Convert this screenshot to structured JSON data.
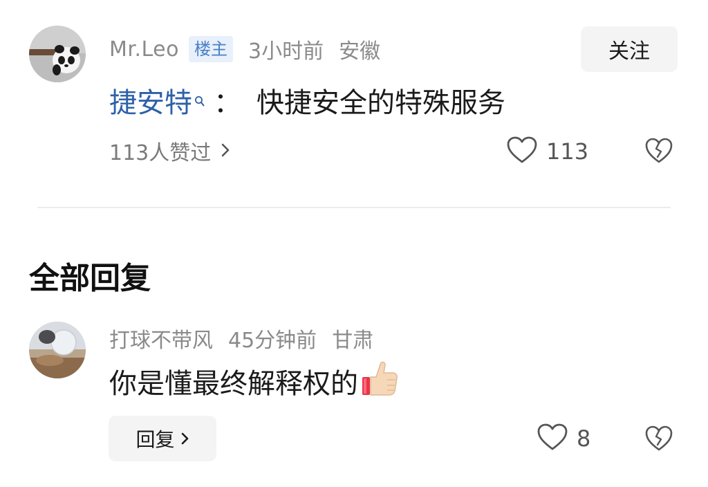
{
  "post": {
    "author": "Mr.Leo",
    "badge": "楼主",
    "time": "3小时前",
    "location": "安徽",
    "follow_label": "关注",
    "keyword": "捷安特",
    "colon": "：",
    "text": "快捷安全的特殊服务",
    "likers_text": "113人赞过",
    "like_count": "113",
    "icons": {
      "avatar": "panda-avatar",
      "keyword_search": "search-icon",
      "likers_arrow": "chevron-right-icon",
      "like": "heart-icon",
      "dislike": "broken-heart-icon"
    }
  },
  "replies_section": {
    "title": "全部回复"
  },
  "reply": {
    "author": "打球不带风",
    "time": "45分钟前",
    "location": "甘肃",
    "text": "你是懂最终解释权的",
    "emoji": "thumbs-up-icon",
    "reply_label": "回复",
    "like_count": "8"
  },
  "colors": {
    "link": "#2d61a8",
    "badge_bg": "#e8f0fb",
    "badge_text": "#4a7fc7",
    "muted": "#8a8a8a",
    "button_bg": "#f4f4f5"
  }
}
